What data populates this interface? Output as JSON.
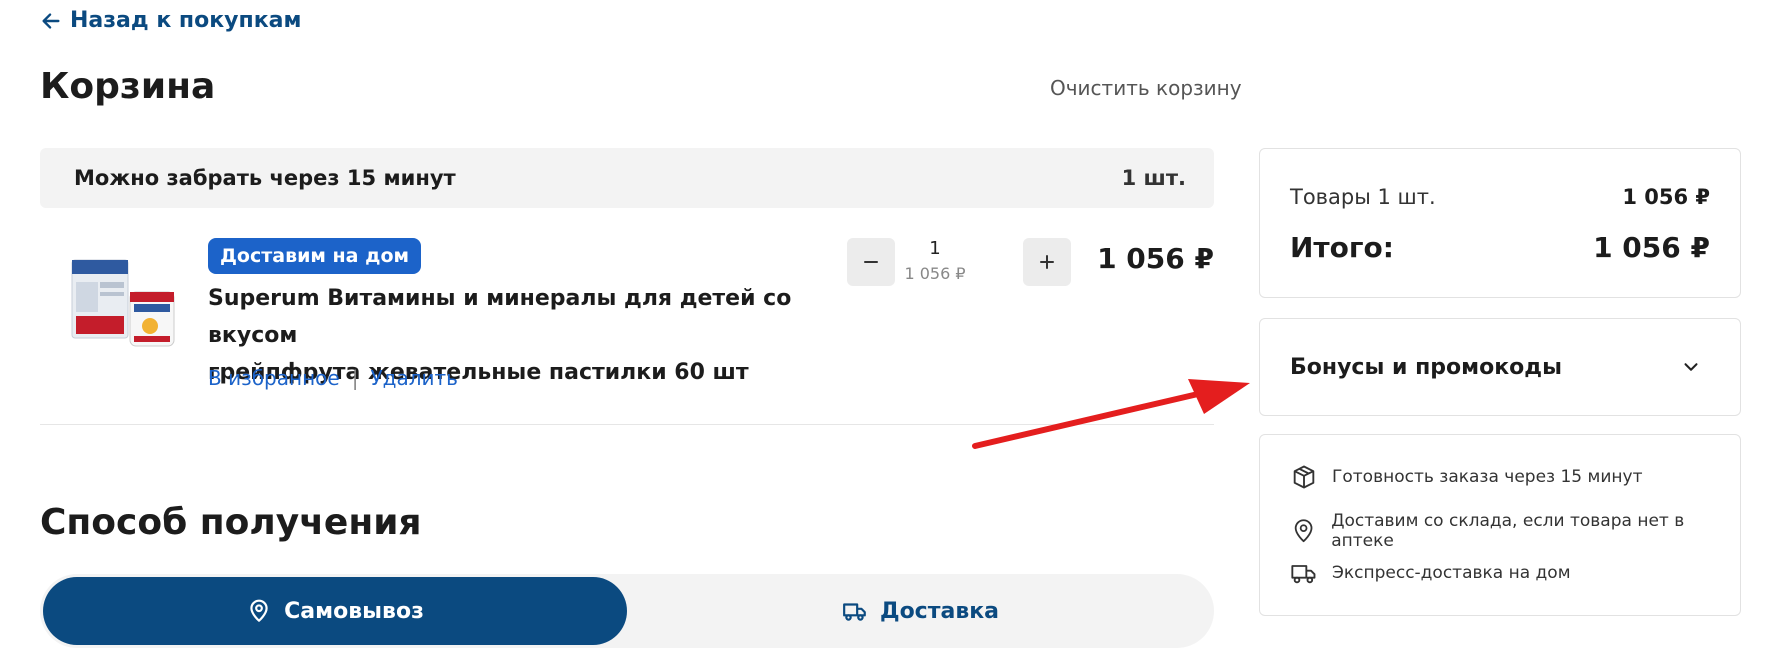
{
  "header": {
    "back_label": "Назад к покупкам",
    "title": "Корзина",
    "clear_cart_label": "Очистить корзину"
  },
  "pickup_group": {
    "title": "Можно забрать через 15 минут",
    "count": "1 шт."
  },
  "cart_item": {
    "badge": "Доставим на дом",
    "name_line1": "Superum Витамины и минералы для детей со вкусом",
    "name_line2": "грейпфрута жевательные пастилки 60 шт",
    "favorite_label": "В избранное",
    "separator": "|",
    "delete_label": "Удалить",
    "quantity": "1",
    "unit_price": "1 056 ₽",
    "total_price": "1 056 ₽"
  },
  "receive_method": {
    "title": "Способ получения",
    "options": [
      {
        "label": "Самовывоз",
        "icon": "map-pin-icon",
        "selected": true
      },
      {
        "label": "Доставка",
        "icon": "truck-icon",
        "selected": false
      }
    ]
  },
  "summary": {
    "items_label": "Товары 1 шт.",
    "items_value": "1 056 ₽",
    "total_label": "Итого:",
    "total_value": "1 056 ₽"
  },
  "bonus": {
    "label": "Бонусы и промокоды",
    "icon": "chevron-down-icon"
  },
  "info": [
    {
      "icon": "box-icon",
      "text": "Готовность заказа через 15 минут"
    },
    {
      "icon": "map-pin-icon",
      "text": "Доставим со склада, если товара нет в аптеке"
    },
    {
      "icon": "truck-icon",
      "text": "Экспресс-доставка на дом"
    }
  ],
  "colors": {
    "brand_dark": "#0b4a80",
    "brand_blue": "#1c63c9",
    "annotation_red": "#e41e1e",
    "panel_gray": "#f3f3f3"
  }
}
